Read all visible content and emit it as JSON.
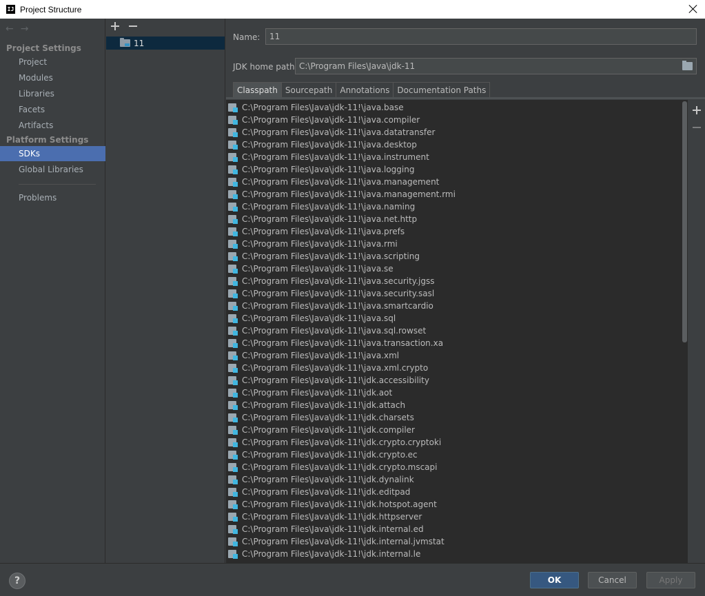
{
  "window": {
    "title": "Project Structure",
    "app_icon": "IJ"
  },
  "sidebar": {
    "arrows": {
      "back": "←",
      "forward": "→"
    },
    "groups": [
      {
        "label": "Project Settings",
        "items": [
          "Project",
          "Modules",
          "Libraries",
          "Facets",
          "Artifacts"
        ]
      },
      {
        "label": "Platform Settings",
        "items": [
          "SDKs",
          "Global Libraries"
        ]
      }
    ],
    "problems": "Problems",
    "selected": "SDKs"
  },
  "sdk_list": {
    "items": [
      "11"
    ]
  },
  "form": {
    "name_label": "Name:",
    "name_value": "11",
    "home_label": "JDK home path:",
    "home_value": "C:\\Program Files\\Java\\jdk-11"
  },
  "tabs": [
    "Classpath",
    "Sourcepath",
    "Annotations",
    "Documentation Paths"
  ],
  "active_tab": "Classpath",
  "classpath": {
    "prefix": "C:\\Program Files\\Java\\jdk-11!\\",
    "modules": [
      "java.base",
      "java.compiler",
      "java.datatransfer",
      "java.desktop",
      "java.instrument",
      "java.logging",
      "java.management",
      "java.management.rmi",
      "java.naming",
      "java.net.http",
      "java.prefs",
      "java.rmi",
      "java.scripting",
      "java.se",
      "java.security.jgss",
      "java.security.sasl",
      "java.smartcardio",
      "java.sql",
      "java.sql.rowset",
      "java.transaction.xa",
      "java.xml",
      "java.xml.crypto",
      "jdk.accessibility",
      "jdk.aot",
      "jdk.attach",
      "jdk.charsets",
      "jdk.compiler",
      "jdk.crypto.cryptoki",
      "jdk.crypto.ec",
      "jdk.crypto.mscapi",
      "jdk.dynalink",
      "jdk.editpad",
      "jdk.hotspot.agent",
      "jdk.httpserver",
      "jdk.internal.ed",
      "jdk.internal.jvmstat",
      "jdk.internal.le"
    ]
  },
  "footer": {
    "help": "?",
    "ok": "OK",
    "cancel": "Cancel",
    "apply": "Apply"
  },
  "colors": {
    "selection": "#4b6eaf",
    "ok_button": "#365880",
    "background": "#3c3f41",
    "list_background": "#2b2b2b"
  }
}
